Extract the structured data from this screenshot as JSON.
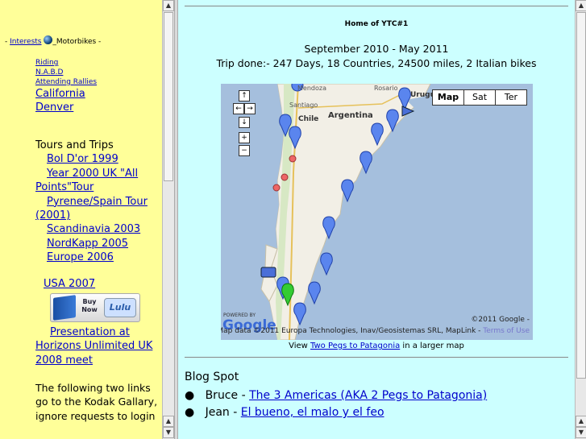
{
  "left": {
    "interests_prefix": "- ",
    "interests_link": "Interests",
    "motorbikes": "_Motorbikes -",
    "sub_links": [
      "Riding",
      "N.A.B.D",
      "Attending Rallies"
    ],
    "places": [
      "California",
      "Denver"
    ],
    "tours_heading": "Tours and Trips",
    "tours": [
      "Bol D'or 1999",
      "Year 2000 UK \"All Points\"Tour",
      "Pyrenee/Spain Tour (2001)",
      "Scandinavia 2003",
      "NordKapp 2005",
      "Europe 2006"
    ],
    "usa": "USA 2007",
    "buynow": "Buy Now",
    "lulu": "Lulu",
    "presentation": "Presentation at Horizons Unlimited UK 2008 meet",
    "kodak_text": "The following two links go to the Kodak Gallary, ignore requests to login"
  },
  "right": {
    "home_title": "Home of YTC#1",
    "dates": "September 2010 - May 2011",
    "trip": "Trip done:- 247 Days, 18 Countries, 24500 miles, 2 Italian bikes",
    "map": {
      "buttons": [
        "Map",
        "Sat",
        "Ter"
      ],
      "labels": {
        "mendoza": "Mendoza",
        "rosario": "Rosario",
        "uruguay": "Urugu",
        "santiago": "Santiago",
        "chile": "Chile",
        "argentina": "Argentina"
      },
      "powered": "POWERED BY",
      "google": "Google",
      "copyright": "©2011 Google -",
      "mapdata": "Map data ©2011 Europa Technologies, Inav/Geosistemas SRL, MapLink - ",
      "terms": "Terms of Use",
      "nav_icons": [
        "↑",
        "←",
        "→",
        "↓",
        "+",
        "−"
      ]
    },
    "view_prefix": "View ",
    "view_link": "Two Pegs to Patagonia",
    "view_suffix": " in a larger map",
    "blog_title": "Blog Spot",
    "blogs": [
      {
        "name": "Bruce - ",
        "link": "The 3 Americas (AKA 2 Pegs to Patagonia)"
      },
      {
        "name": "Jean - ",
        "link": "El bueno, el malo y el feo"
      }
    ]
  },
  "colors": {
    "left_bg": "#ffff99",
    "right_bg": "#ccffff"
  }
}
